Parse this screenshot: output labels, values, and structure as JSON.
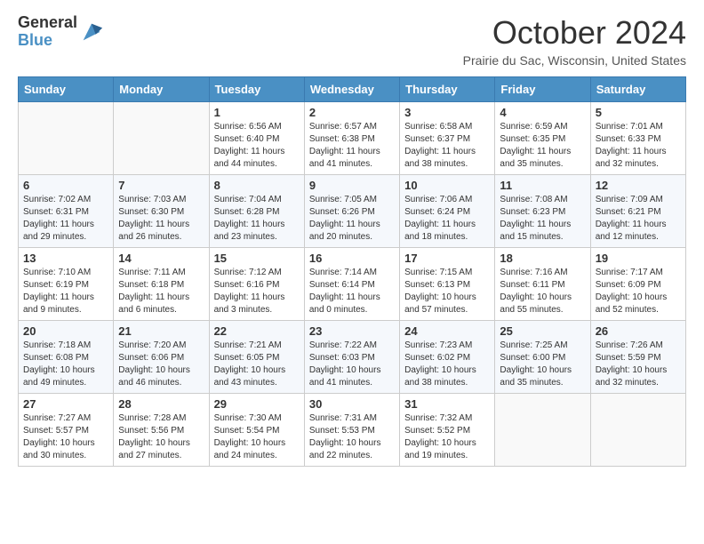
{
  "header": {
    "logo_general": "General",
    "logo_blue": "Blue",
    "month_title": "October 2024",
    "location": "Prairie du Sac, Wisconsin, United States"
  },
  "weekdays": [
    "Sunday",
    "Monday",
    "Tuesday",
    "Wednesday",
    "Thursday",
    "Friday",
    "Saturday"
  ],
  "weeks": [
    [
      {
        "day": "",
        "sunrise": "",
        "sunset": "",
        "daylight": ""
      },
      {
        "day": "",
        "sunrise": "",
        "sunset": "",
        "daylight": ""
      },
      {
        "day": "1",
        "sunrise": "Sunrise: 6:56 AM",
        "sunset": "Sunset: 6:40 PM",
        "daylight": "Daylight: 11 hours and 44 minutes."
      },
      {
        "day": "2",
        "sunrise": "Sunrise: 6:57 AM",
        "sunset": "Sunset: 6:38 PM",
        "daylight": "Daylight: 11 hours and 41 minutes."
      },
      {
        "day": "3",
        "sunrise": "Sunrise: 6:58 AM",
        "sunset": "Sunset: 6:37 PM",
        "daylight": "Daylight: 11 hours and 38 minutes."
      },
      {
        "day": "4",
        "sunrise": "Sunrise: 6:59 AM",
        "sunset": "Sunset: 6:35 PM",
        "daylight": "Daylight: 11 hours and 35 minutes."
      },
      {
        "day": "5",
        "sunrise": "Sunrise: 7:01 AM",
        "sunset": "Sunset: 6:33 PM",
        "daylight": "Daylight: 11 hours and 32 minutes."
      }
    ],
    [
      {
        "day": "6",
        "sunrise": "Sunrise: 7:02 AM",
        "sunset": "Sunset: 6:31 PM",
        "daylight": "Daylight: 11 hours and 29 minutes."
      },
      {
        "day": "7",
        "sunrise": "Sunrise: 7:03 AM",
        "sunset": "Sunset: 6:30 PM",
        "daylight": "Daylight: 11 hours and 26 minutes."
      },
      {
        "day": "8",
        "sunrise": "Sunrise: 7:04 AM",
        "sunset": "Sunset: 6:28 PM",
        "daylight": "Daylight: 11 hours and 23 minutes."
      },
      {
        "day": "9",
        "sunrise": "Sunrise: 7:05 AM",
        "sunset": "Sunset: 6:26 PM",
        "daylight": "Daylight: 11 hours and 20 minutes."
      },
      {
        "day": "10",
        "sunrise": "Sunrise: 7:06 AM",
        "sunset": "Sunset: 6:24 PM",
        "daylight": "Daylight: 11 hours and 18 minutes."
      },
      {
        "day": "11",
        "sunrise": "Sunrise: 7:08 AM",
        "sunset": "Sunset: 6:23 PM",
        "daylight": "Daylight: 11 hours and 15 minutes."
      },
      {
        "day": "12",
        "sunrise": "Sunrise: 7:09 AM",
        "sunset": "Sunset: 6:21 PM",
        "daylight": "Daylight: 11 hours and 12 minutes."
      }
    ],
    [
      {
        "day": "13",
        "sunrise": "Sunrise: 7:10 AM",
        "sunset": "Sunset: 6:19 PM",
        "daylight": "Daylight: 11 hours and 9 minutes."
      },
      {
        "day": "14",
        "sunrise": "Sunrise: 7:11 AM",
        "sunset": "Sunset: 6:18 PM",
        "daylight": "Daylight: 11 hours and 6 minutes."
      },
      {
        "day": "15",
        "sunrise": "Sunrise: 7:12 AM",
        "sunset": "Sunset: 6:16 PM",
        "daylight": "Daylight: 11 hours and 3 minutes."
      },
      {
        "day": "16",
        "sunrise": "Sunrise: 7:14 AM",
        "sunset": "Sunset: 6:14 PM",
        "daylight": "Daylight: 11 hours and 0 minutes."
      },
      {
        "day": "17",
        "sunrise": "Sunrise: 7:15 AM",
        "sunset": "Sunset: 6:13 PM",
        "daylight": "Daylight: 10 hours and 57 minutes."
      },
      {
        "day": "18",
        "sunrise": "Sunrise: 7:16 AM",
        "sunset": "Sunset: 6:11 PM",
        "daylight": "Daylight: 10 hours and 55 minutes."
      },
      {
        "day": "19",
        "sunrise": "Sunrise: 7:17 AM",
        "sunset": "Sunset: 6:09 PM",
        "daylight": "Daylight: 10 hours and 52 minutes."
      }
    ],
    [
      {
        "day": "20",
        "sunrise": "Sunrise: 7:18 AM",
        "sunset": "Sunset: 6:08 PM",
        "daylight": "Daylight: 10 hours and 49 minutes."
      },
      {
        "day": "21",
        "sunrise": "Sunrise: 7:20 AM",
        "sunset": "Sunset: 6:06 PM",
        "daylight": "Daylight: 10 hours and 46 minutes."
      },
      {
        "day": "22",
        "sunrise": "Sunrise: 7:21 AM",
        "sunset": "Sunset: 6:05 PM",
        "daylight": "Daylight: 10 hours and 43 minutes."
      },
      {
        "day": "23",
        "sunrise": "Sunrise: 7:22 AM",
        "sunset": "Sunset: 6:03 PM",
        "daylight": "Daylight: 10 hours and 41 minutes."
      },
      {
        "day": "24",
        "sunrise": "Sunrise: 7:23 AM",
        "sunset": "Sunset: 6:02 PM",
        "daylight": "Daylight: 10 hours and 38 minutes."
      },
      {
        "day": "25",
        "sunrise": "Sunrise: 7:25 AM",
        "sunset": "Sunset: 6:00 PM",
        "daylight": "Daylight: 10 hours and 35 minutes."
      },
      {
        "day": "26",
        "sunrise": "Sunrise: 7:26 AM",
        "sunset": "Sunset: 5:59 PM",
        "daylight": "Daylight: 10 hours and 32 minutes."
      }
    ],
    [
      {
        "day": "27",
        "sunrise": "Sunrise: 7:27 AM",
        "sunset": "Sunset: 5:57 PM",
        "daylight": "Daylight: 10 hours and 30 minutes."
      },
      {
        "day": "28",
        "sunrise": "Sunrise: 7:28 AM",
        "sunset": "Sunset: 5:56 PM",
        "daylight": "Daylight: 10 hours and 27 minutes."
      },
      {
        "day": "29",
        "sunrise": "Sunrise: 7:30 AM",
        "sunset": "Sunset: 5:54 PM",
        "daylight": "Daylight: 10 hours and 24 minutes."
      },
      {
        "day": "30",
        "sunrise": "Sunrise: 7:31 AM",
        "sunset": "Sunset: 5:53 PM",
        "daylight": "Daylight: 10 hours and 22 minutes."
      },
      {
        "day": "31",
        "sunrise": "Sunrise: 7:32 AM",
        "sunset": "Sunset: 5:52 PM",
        "daylight": "Daylight: 10 hours and 19 minutes."
      },
      {
        "day": "",
        "sunrise": "",
        "sunset": "",
        "daylight": ""
      },
      {
        "day": "",
        "sunrise": "",
        "sunset": "",
        "daylight": ""
      }
    ]
  ]
}
